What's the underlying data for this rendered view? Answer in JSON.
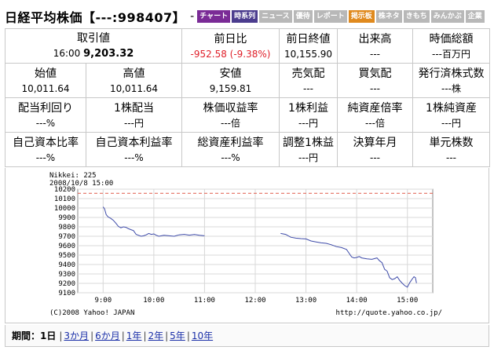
{
  "header": {
    "title": "日経平均株価【---:998407】",
    "dash": "-",
    "tabs": [
      {
        "label": "チャート",
        "color": "#7a2b96"
      },
      {
        "label": "時系列",
        "color": "#4b3c8e"
      },
      {
        "label": "ニュース",
        "color": "#b8b8b8"
      },
      {
        "label": "優待",
        "color": "#b8b8b8"
      },
      {
        "label": "レポート",
        "color": "#b8b8b8"
      },
      {
        "label": "掲示板",
        "color": "#e08a1e"
      },
      {
        "label": "株ネタ",
        "color": "#b8b8b8"
      },
      {
        "label": "きもち",
        "color": "#b8b8b8"
      },
      {
        "label": "みんかぶ",
        "color": "#b8b8b8"
      },
      {
        "label": "企業",
        "color": "#b8b8b8"
      }
    ]
  },
  "quote": {
    "row1": {
      "last": {
        "label": "取引値",
        "time": "16:00",
        "price": "9,203.32"
      },
      "change": {
        "label": "前日比",
        "value": "-952.58 (-9.38%)"
      },
      "prev_close": {
        "label": "前日終値",
        "value": "10,155.90"
      },
      "volume": {
        "label": "出来高",
        "value": "---"
      },
      "market_cap": {
        "label": "時価総額",
        "value": "---百万円"
      }
    },
    "row2": {
      "open": {
        "label": "始値",
        "value": "10,011.64"
      },
      "high": {
        "label": "高値",
        "value": "10,011.64"
      },
      "low": {
        "label": "安値",
        "value": "9,159.81"
      },
      "ask": {
        "label": "売気配",
        "value": "---"
      },
      "bid": {
        "label": "買気配",
        "value": "---"
      },
      "shares": {
        "label": "発行済株式数",
        "value": "---株"
      }
    },
    "row3": {
      "div_yield": {
        "label": "配当利回り",
        "value": "---%"
      },
      "div_per_share": {
        "label": "1株配当",
        "value": "---円"
      },
      "per": {
        "label": "株価収益率",
        "value": "---倍"
      },
      "eps": {
        "label": "1株利益",
        "value": "---円"
      },
      "pbr": {
        "label": "純資産倍率",
        "value": "---倍"
      },
      "bps": {
        "label": "1株純資産",
        "value": "---円"
      }
    },
    "row4": {
      "equity_ratio": {
        "label": "自己資本比率",
        "value": "---%"
      },
      "roe": {
        "label": "自己資本利益率",
        "value": "---%"
      },
      "roa": {
        "label": "総資産利益率",
        "value": "---%"
      },
      "adj_eps": {
        "label": "調整1株益",
        "value": "---円"
      },
      "fiscal": {
        "label": "決算年月",
        "value": "---"
      },
      "unit": {
        "label": "単元株数",
        "value": "---"
      }
    }
  },
  "chart_data": {
    "type": "line",
    "title": "Nikkei: 225",
    "subtitle": "2008/10/8 15:00",
    "x_ticks": [
      "9:00",
      "10:00",
      "11:00",
      "12:00",
      "13:00",
      "14:00",
      "15:00"
    ],
    "y_ticks": [
      9100,
      9200,
      9300,
      9400,
      9500,
      9600,
      9700,
      9800,
      9900,
      10000,
      10100,
      10200
    ],
    "ylim": [
      9100,
      10200
    ],
    "xlim": [
      8.5,
      15.5
    ],
    "prev_close_line": 10155.9,
    "grid": true,
    "copyright": "(C)2008 Yahoo! JAPAN",
    "source_url": "http://quote.yahoo.co.jp/",
    "series": [
      {
        "segments": [
          [
            [
              9.0,
              10011.64
            ],
            [
              9.03,
              9990
            ],
            [
              9.06,
              9930
            ],
            [
              9.1,
              9905
            ],
            [
              9.15,
              9890
            ],
            [
              9.2,
              9870
            ],
            [
              9.25,
              9840
            ],
            [
              9.3,
              9805
            ],
            [
              9.35,
              9790
            ],
            [
              9.4,
              9800
            ],
            [
              9.45,
              9795
            ],
            [
              9.5,
              9780
            ],
            [
              9.55,
              9770
            ],
            [
              9.6,
              9760
            ],
            [
              9.65,
              9720
            ],
            [
              9.7,
              9710
            ],
            [
              9.75,
              9700
            ],
            [
              9.8,
              9705
            ],
            [
              9.85,
              9715
            ],
            [
              9.9,
              9730
            ],
            [
              9.95,
              9720
            ],
            [
              10.0,
              9725
            ],
            [
              10.05,
              9710
            ],
            [
              10.1,
              9700
            ],
            [
              10.2,
              9710
            ],
            [
              10.3,
              9705
            ],
            [
              10.4,
              9700
            ],
            [
              10.5,
              9715
            ],
            [
              10.6,
              9720
            ],
            [
              10.7,
              9712
            ],
            [
              10.8,
              9718
            ],
            [
              10.9,
              9710
            ],
            [
              11.0,
              9705
            ]
          ],
          [
            [
              12.5,
              9730
            ],
            [
              12.6,
              9720
            ],
            [
              12.7,
              9690
            ],
            [
              12.8,
              9680
            ],
            [
              12.9,
              9675
            ],
            [
              13.0,
              9672
            ],
            [
              13.1,
              9650
            ],
            [
              13.2,
              9640
            ],
            [
              13.3,
              9630
            ],
            [
              13.4,
              9625
            ],
            [
              13.5,
              9610
            ],
            [
              13.6,
              9590
            ],
            [
              13.7,
              9580
            ],
            [
              13.8,
              9560
            ],
            [
              13.85,
              9520
            ],
            [
              13.9,
              9480
            ],
            [
              13.95,
              9470
            ],
            [
              14.0,
              9475
            ],
            [
              14.05,
              9485
            ],
            [
              14.1,
              9470
            ],
            [
              14.2,
              9460
            ],
            [
              14.3,
              9455
            ],
            [
              14.4,
              9470
            ],
            [
              14.45,
              9440
            ],
            [
              14.5,
              9420
            ],
            [
              14.55,
              9350
            ],
            [
              14.6,
              9330
            ],
            [
              14.65,
              9260
            ],
            [
              14.7,
              9240
            ],
            [
              14.75,
              9250
            ],
            [
              14.8,
              9270
            ],
            [
              14.85,
              9230
            ],
            [
              14.9,
              9200
            ],
            [
              14.95,
              9175
            ],
            [
              15.0,
              9160
            ],
            [
              15.05,
              9210
            ],
            [
              15.1,
              9250
            ],
            [
              15.13,
              9270
            ],
            [
              15.16,
              9260
            ],
            [
              15.18,
              9203
            ]
          ]
        ]
      }
    ]
  },
  "period_bar": {
    "label": "期間：",
    "current": "1日",
    "links": [
      "3か月",
      "6か月",
      "1年",
      "2年",
      "5年",
      "10年"
    ]
  }
}
